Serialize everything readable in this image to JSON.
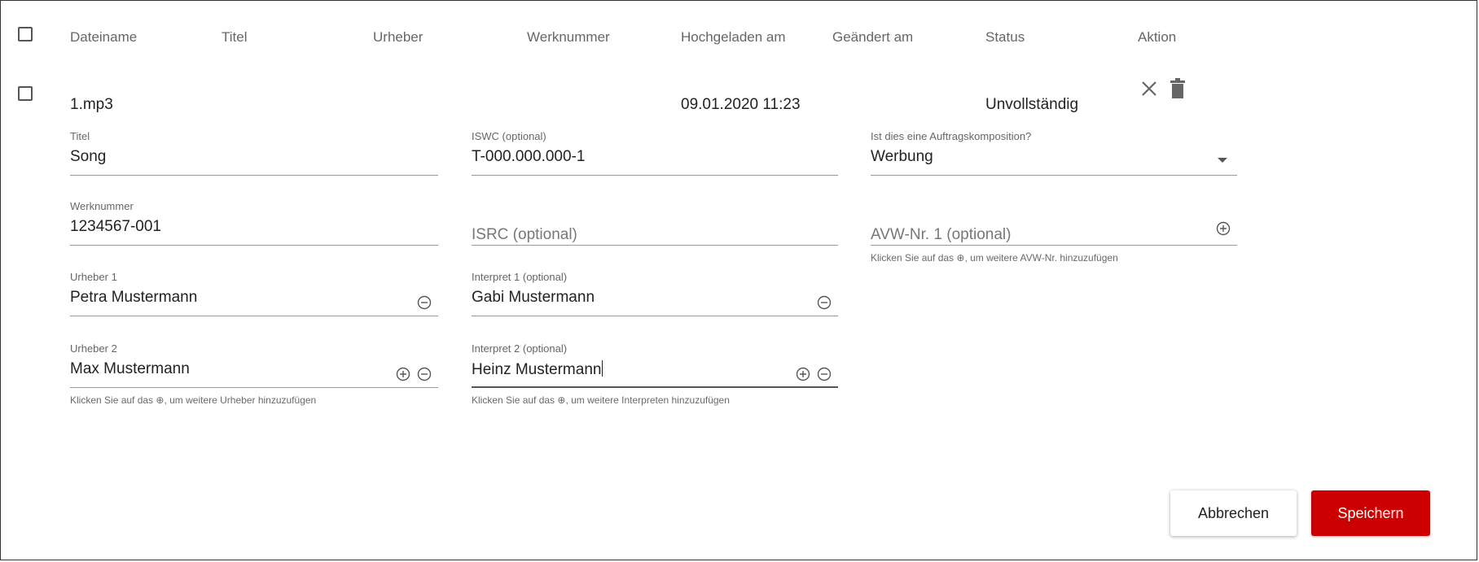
{
  "table": {
    "headers": {
      "filename": "Dateiname",
      "title": "Titel",
      "author": "Urheber",
      "work_number": "Werknummer",
      "uploaded": "Hochgeladen am",
      "modified": "Geändert am",
      "status": "Status",
      "action": "Aktion"
    },
    "row": {
      "filename": "1.mp3",
      "uploaded": "09.01.2020 11:23",
      "status": "Unvollständig"
    }
  },
  "form": {
    "title": {
      "label": "Titel",
      "value": "Song"
    },
    "iswc": {
      "label": "ISWC (optional)",
      "value": "T-000.000.000-1"
    },
    "commission": {
      "label": "Ist dies eine Auftragskomposition?",
      "value": "Werbung"
    },
    "work_number": {
      "label": "Werknummer",
      "value": "1234567-001"
    },
    "isrc": {
      "placeholder": "ISRC (optional)"
    },
    "avw": {
      "placeholder": "AVW-Nr. 1 (optional)",
      "hint": "Klicken Sie auf das ⊕, um weitere AVW-Nr. hinzuzufügen"
    },
    "author1": {
      "label": "Urheber 1",
      "value": "Petra Mustermann"
    },
    "performer1": {
      "label": "Interpret 1 (optional)",
      "value": "Gabi Mustermann"
    },
    "author2": {
      "label": "Urheber 2",
      "value": "Max Mustermann"
    },
    "performer2": {
      "label": "Interpret 2 (optional)",
      "value": "Heinz Mustermann"
    },
    "author_hint": "Klicken Sie auf das ⊕, um weitere Urheber hinzuzufügen",
    "performer_hint": "Klicken Sie auf das ⊕, um weitere Interpreten hinzuzufügen"
  },
  "buttons": {
    "cancel": "Abbrechen",
    "save": "Speichern"
  },
  "colors": {
    "accent": "#cc0000",
    "text": "#222222",
    "muted": "#666666"
  }
}
